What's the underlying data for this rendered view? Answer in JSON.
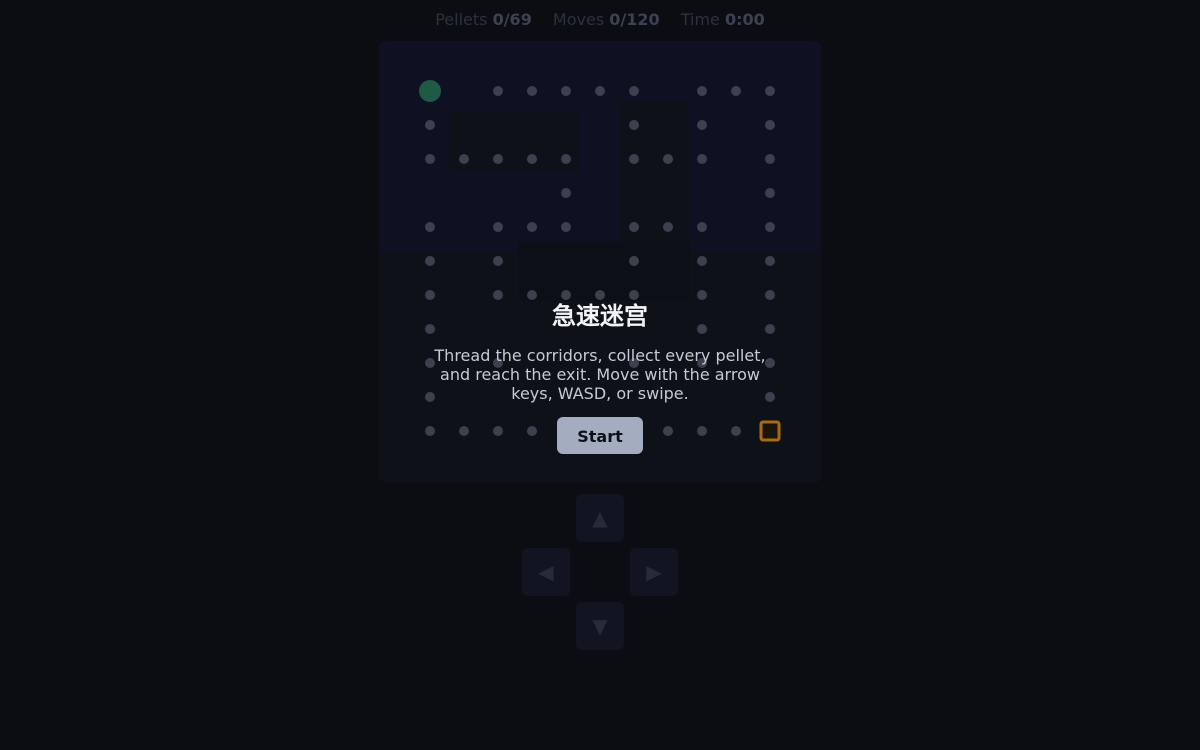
{
  "title": "急速迷宫",
  "hud": {
    "pellets_label": "Pellets",
    "pellets_value": "0/69",
    "moves_label": "Moves",
    "moves_value": "0/120",
    "time_label": "Time",
    "time_value": "0:00"
  },
  "dialog": {
    "title": "急速迷宫",
    "description": "Thread the corridors, collect every pellet, and reach the exit. Move with the arrow keys, WASD, or swipe.",
    "start_label": "Start"
  },
  "dpad": {
    "up": "▲",
    "left": "◀",
    "right": "▶",
    "down": "▼"
  },
  "maze": {
    "player": [
      0,
      0
    ],
    "exit": [
      10,
      10
    ],
    "pellets": [
      [
        2,
        0
      ],
      [
        3,
        0
      ],
      [
        4,
        0
      ],
      [
        5,
        0
      ],
      [
        6,
        0
      ],
      [
        8,
        0
      ],
      [
        9,
        0
      ],
      [
        10,
        0
      ],
      [
        0,
        1
      ],
      [
        6,
        1
      ],
      [
        8,
        1
      ],
      [
        10,
        1
      ],
      [
        0,
        2
      ],
      [
        1,
        2
      ],
      [
        2,
        2
      ],
      [
        3,
        2
      ],
      [
        4,
        2
      ],
      [
        6,
        2
      ],
      [
        7,
        2
      ],
      [
        8,
        2
      ],
      [
        10,
        2
      ],
      [
        4,
        3
      ],
      [
        10,
        3
      ],
      [
        0,
        4
      ],
      [
        2,
        4
      ],
      [
        3,
        4
      ],
      [
        4,
        4
      ],
      [
        6,
        4
      ],
      [
        7,
        4
      ],
      [
        8,
        4
      ],
      [
        10,
        4
      ],
      [
        0,
        5
      ],
      [
        2,
        5
      ],
      [
        6,
        5
      ],
      [
        8,
        5
      ],
      [
        10,
        5
      ],
      [
        0,
        6
      ],
      [
        2,
        6
      ],
      [
        3,
        6
      ],
      [
        4,
        6
      ],
      [
        5,
        6
      ],
      [
        6,
        6
      ],
      [
        8,
        6
      ],
      [
        10,
        6
      ],
      [
        0,
        7
      ],
      [
        8,
        7
      ],
      [
        10,
        7
      ],
      [
        0,
        8
      ],
      [
        2,
        8
      ],
      [
        6,
        8
      ],
      [
        8,
        8
      ],
      [
        10,
        8
      ],
      [
        0,
        9
      ],
      [
        10,
        9
      ],
      [
        0,
        10
      ],
      [
        1,
        10
      ],
      [
        2,
        10
      ],
      [
        3,
        10
      ],
      [
        7,
        10
      ],
      [
        8,
        10
      ],
      [
        9,
        10
      ]
    ]
  },
  "colors": {
    "background": "#0b0d13",
    "board": "#0f1119",
    "wall_tint": "#11142a",
    "pellet": "#3c414e",
    "player": "#1f5a45",
    "exit": "#a86a18"
  }
}
